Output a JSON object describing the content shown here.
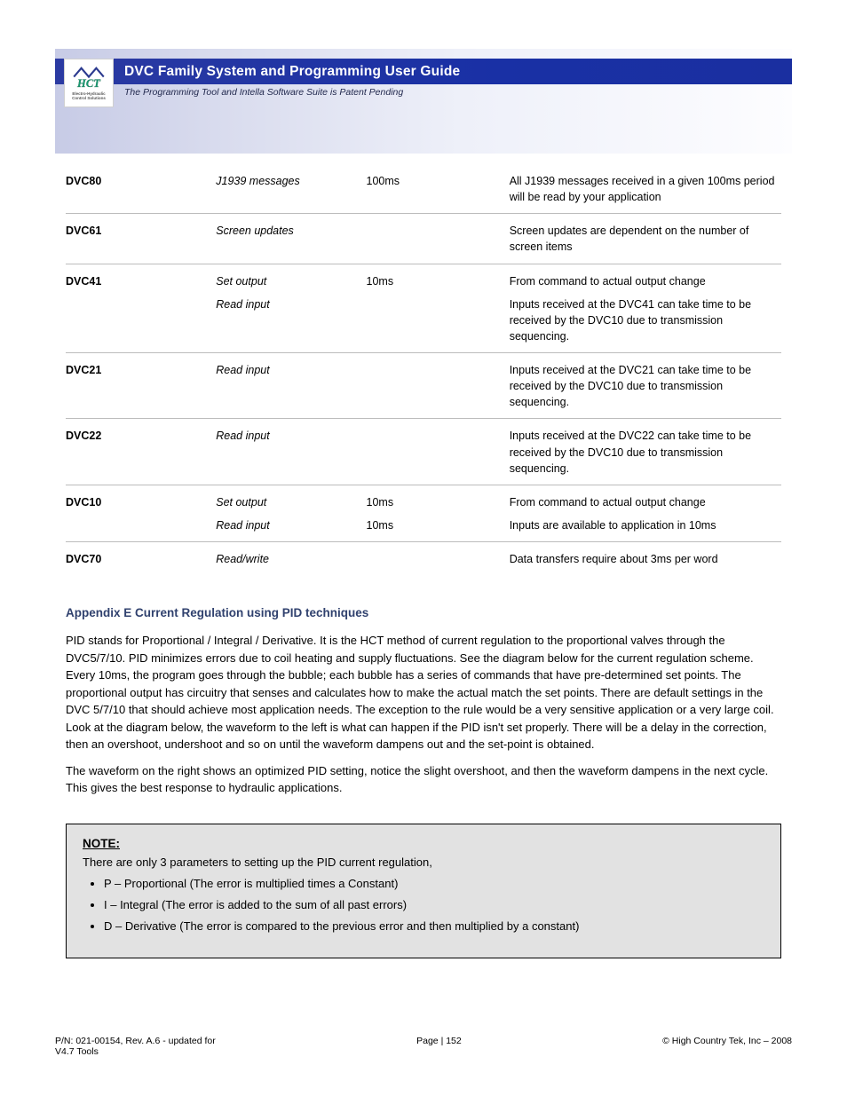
{
  "header": {
    "title_bar": "DVC Family System and Programming User Guide",
    "subtitle": "The Programming Tool and Intella Software Suite is Patent Pending",
    "logo_tag_line1": "Electro-Hydraulic",
    "logo_tag_line2": "Control Solutions"
  },
  "table": [
    {
      "c1": "DVC80",
      "c2": "J1939 messages",
      "c3": "100ms",
      "c4": "All J1939 messages received in a given 100ms period will be read by your application"
    },
    {
      "c1": "DVC61",
      "c2": "Screen updates",
      "c3": "",
      "c4": "Screen updates are dependent on the number of screen items"
    },
    {
      "c1": "DVC41",
      "c2": "Set output",
      "c3": "10ms",
      "c4": "From command to actual output change"
    },
    {
      "c1": "",
      "c2": "Read input",
      "c3": "",
      "c4": "Inputs received at the DVC41 can take time to be received by the DVC10 due to transmission sequencing."
    },
    {
      "c1": "DVC21",
      "c2": "Read input",
      "c3": "",
      "c4": "Inputs received at the DVC21 can take time to be received by the DVC10 due to transmission sequencing."
    },
    {
      "c1": "DVC22",
      "c2": "Read input",
      "c3": "",
      "c4": "Inputs received at the DVC22 can take time to be received by the DVC10 due to transmission sequencing."
    },
    {
      "c1": "DVC10",
      "c2": "Set output",
      "c3": "10ms",
      "c4": "From command to actual output change"
    },
    {
      "c1": "",
      "c2": "Read input",
      "c3": "10ms",
      "c4": "Inputs are available to application in 10ms"
    },
    {
      "c1": "DVC70",
      "c2": "Read/write",
      "c3": "",
      "c4": "Data transfers require about 3ms per word"
    }
  ],
  "section2": {
    "heading": "Appendix E  Current Regulation using PID techniques",
    "p1": "PID stands for Proportional / Integral / Derivative. It is the HCT method of current regulation to the proportional valves through the DVC5/7/10. PID minimizes errors due to coil heating and supply fluctuations. See the diagram below for the current regulation scheme.  Every 10ms, the program goes through the bubble; each bubble has a series of commands that have pre-determined set points. The proportional output has circuitry that senses and calculates how to make the actual match the set points. There are default settings in the DVC 5/7/10 that should achieve most application needs. The exception to the rule would be a very sensitive application or a very large coil. Look at the diagram below, the waveform to the left is what can happen if the PID isn't set properly.  There will be a delay in the correction, then an overshoot, undershoot and so on until the waveform dampens out and the set-point is obtained.",
    "p2": "The waveform on the right shows an optimized PID setting, notice the slight overshoot, and then the waveform dampens in the next cycle. This gives the best response to hydraulic applications."
  },
  "note": {
    "title": "NOTE:",
    "subtitle": "There are only 3 parameters to setting up the PID current regulation,",
    "items": [
      "P – Proportional (The error is multiplied times a Constant)",
      "I –  Integral (The error is added to the sum of all past errors)",
      "D – Derivative (The error is compared to the previous error and then multiplied by a constant)"
    ]
  },
  "footer": {
    "left_line1": "P/N: 021-00154, Rev. A.6 - updated for",
    "left_line2": "V4.7 Tools",
    "center_line1": "Page | ",
    "center_page": "152",
    "right": "© High Country Tek, Inc – 2008"
  }
}
